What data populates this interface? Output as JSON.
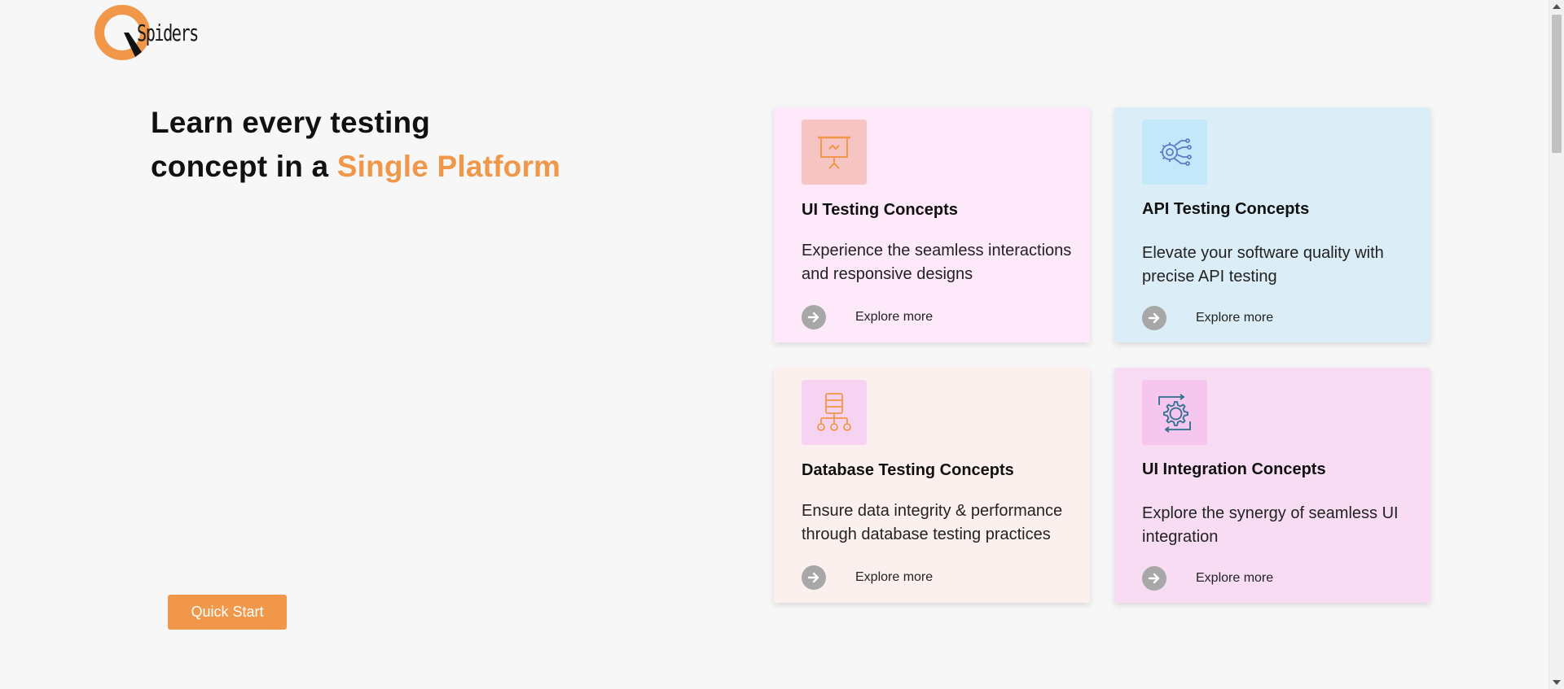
{
  "logo": {
    "text": "Spiders",
    "icon": "q-logo-icon"
  },
  "hero": {
    "title_line1": "Learn every testing",
    "title_line2_prefix": "concept in a ",
    "title_accent": "Single Platform",
    "accent_color": "#f0974a"
  },
  "quick_start": {
    "label": "Quick Start"
  },
  "cards": [
    {
      "title": "UI Testing Concepts",
      "description": "Experience the seamless interactions and responsive designs",
      "explore_label": "Explore more",
      "icon": "presentation-board-icon",
      "background": "#fde9f9"
    },
    {
      "title": "API Testing Concepts",
      "description": "Elevate your software quality with precise API testing",
      "explore_label": "Explore more",
      "icon": "api-gear-circuit-icon",
      "background": "#dbeef7"
    },
    {
      "title": "Database Testing Concepts",
      "description": "Ensure data integrity & performance through database testing practices",
      "explore_label": "Explore more",
      "icon": "database-network-icon",
      "background": "#fcf0ef"
    },
    {
      "title": "UI Integration Concepts",
      "description": "Explore the synergy of seamless UI integration",
      "explore_label": "Explore more",
      "icon": "ui-gear-sync-icon",
      "background": "#f7dcf4"
    }
  ]
}
